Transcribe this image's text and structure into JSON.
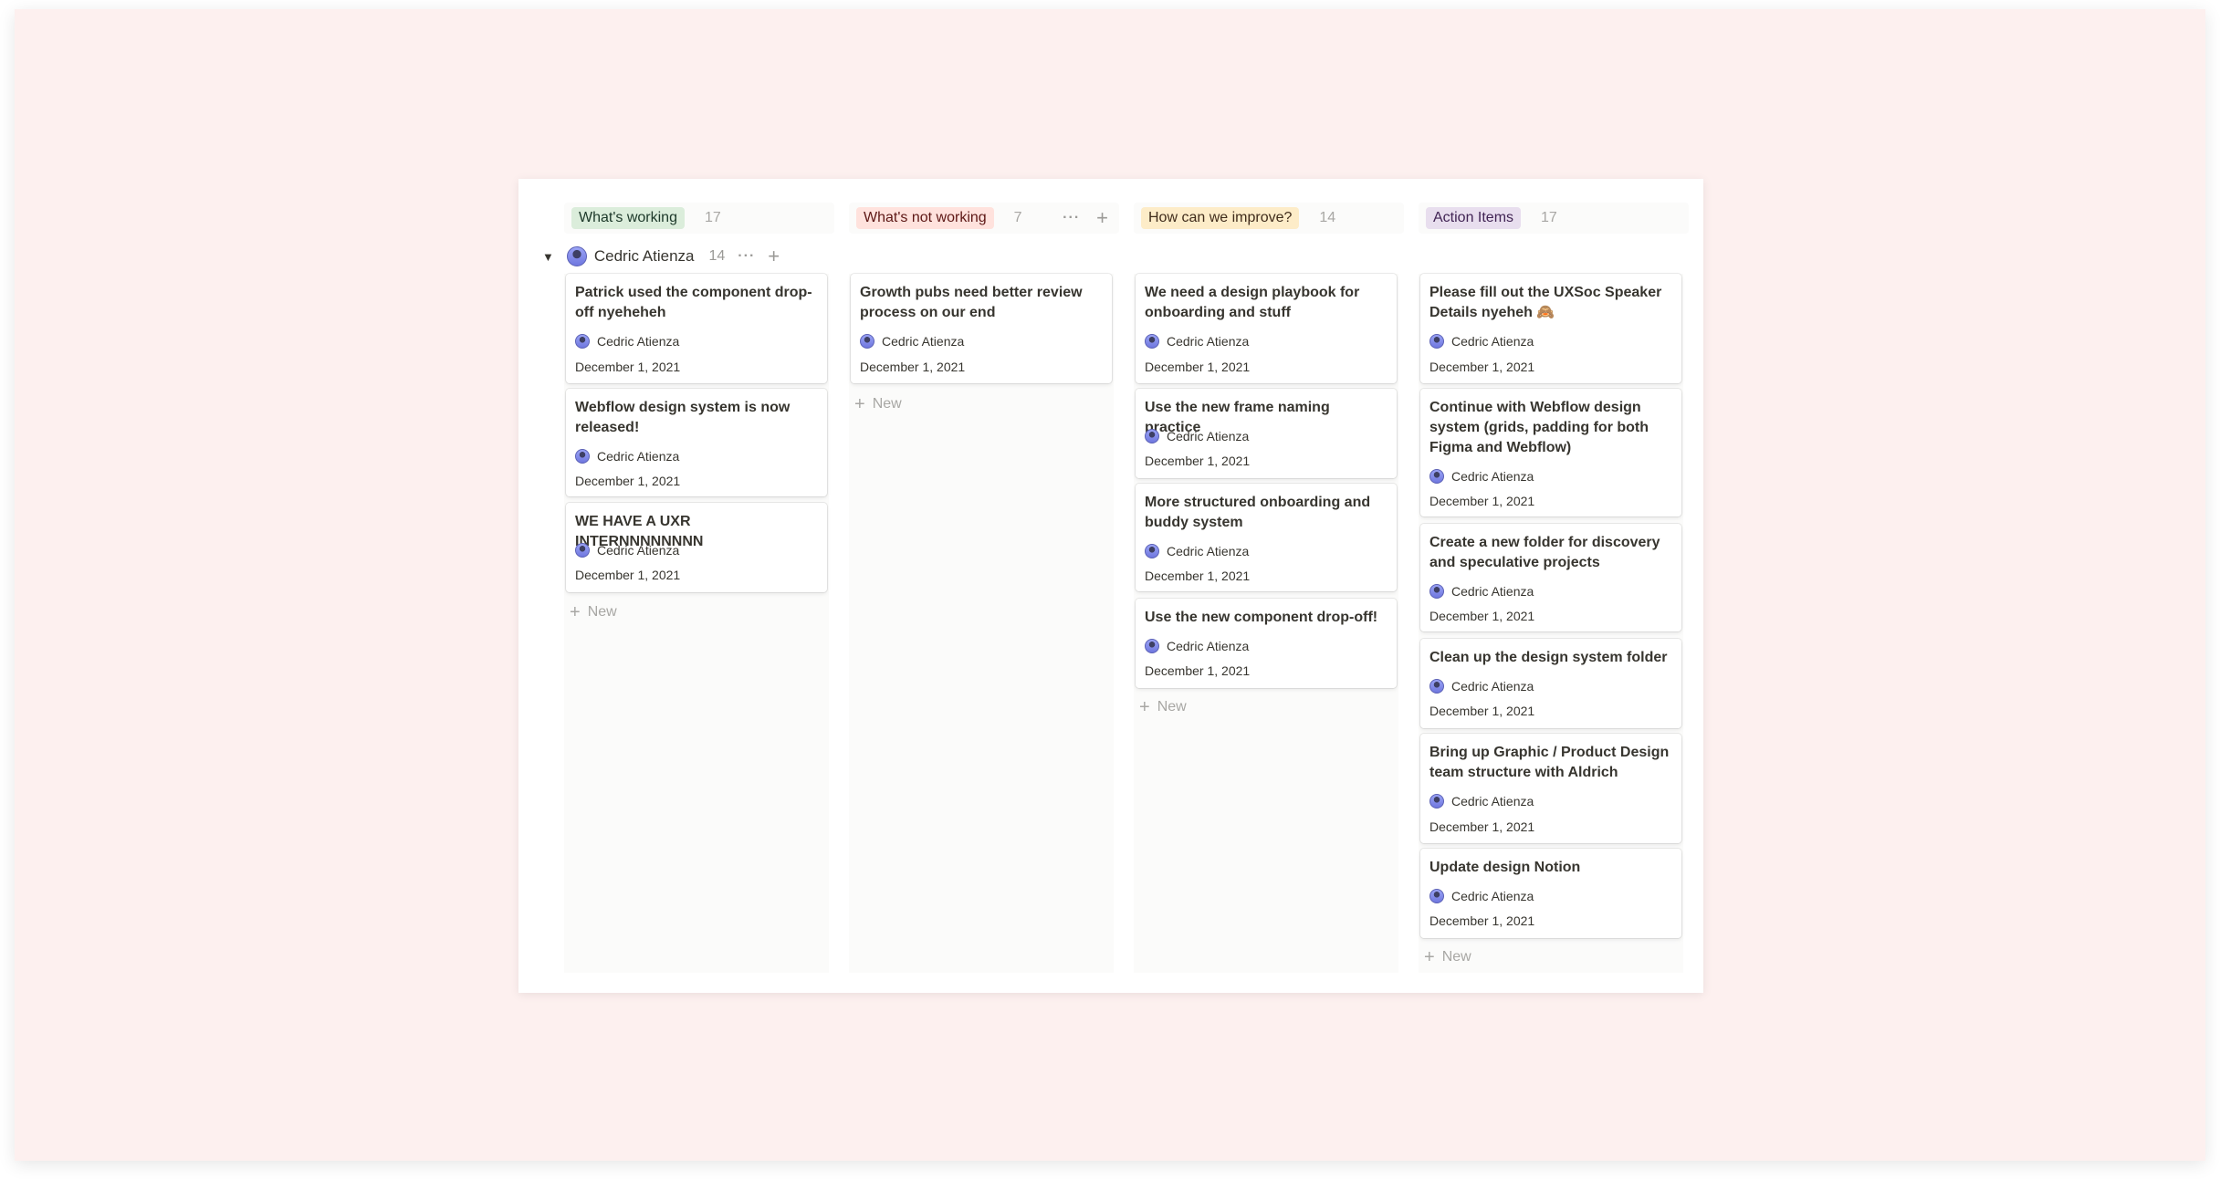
{
  "columns": [
    {
      "title": "What's working",
      "count": "17",
      "pill_bg": "#dbeddb",
      "pill_fg": "#1c3829",
      "cards": [
        {
          "title": "Patrick used the component drop-off nyeheheh",
          "person": "Cedric Atienza",
          "date": "December 1, 2021"
        },
        {
          "title": "Webflow design system is now released!",
          "person": "Cedric Atienza",
          "date": "December 1, 2021"
        },
        {
          "title": "WE HAVE A UXR INTERNNNNNNNN",
          "person": "Cedric Atienza",
          "date": "December 1, 2021"
        }
      ]
    },
    {
      "title": "What's not working",
      "count": "7",
      "pill_bg": "#ffe2dd",
      "pill_fg": "#5d1715",
      "cards": [
        {
          "title": "Growth pubs need better review process on our end",
          "person": "Cedric Atienza",
          "date": "December 1, 2021"
        }
      ]
    },
    {
      "title": "How can we improve?",
      "count": "14",
      "pill_bg": "#fdecc8",
      "pill_fg": "#402c1b",
      "cards": [
        {
          "title": "We need a design playbook for onboarding and stuff",
          "person": "Cedric Atienza",
          "date": "December 1, 2021"
        },
        {
          "title": "Use the new frame naming practice",
          "person": "Cedric Atienza",
          "date": "December 1, 2021"
        },
        {
          "title": "More structured onboarding and buddy system",
          "person": "Cedric Atienza",
          "date": "December 1, 2021"
        },
        {
          "title": "Use the new component drop-off!",
          "person": "Cedric Atienza",
          "date": "December 1, 2021"
        }
      ]
    },
    {
      "title": "Action Items",
      "count": "17",
      "pill_bg": "#e8deee",
      "pill_fg": "#412454",
      "cards": [
        {
          "title": "Please fill out the UXSoc Speaker Details nyeheh 🙈",
          "person": "Cedric Atienza",
          "date": "December 1, 2021"
        },
        {
          "title": "Continue with Webflow design system (grids, padding for both Figma and Webflow)",
          "person": "Cedric Atienza",
          "date": "December 1, 2021"
        },
        {
          "title": "Create a new folder for discovery and speculative projects",
          "person": "Cedric Atienza",
          "date": "December 1, 2021"
        },
        {
          "title": "Clean up the design system folder",
          "person": "Cedric Atienza",
          "date": "December 1, 2021"
        },
        {
          "title": "Bring up Graphic / Product Design team structure with Aldrich",
          "person": "Cedric Atienza",
          "date": "December 1, 2021"
        },
        {
          "title": "Update design Notion",
          "person": "Cedric Atienza",
          "date": "December 1, 2021"
        }
      ]
    }
  ],
  "group": {
    "name": "Cedric Atienza",
    "count": "14"
  },
  "new_label": "New",
  "icons": {
    "caret": "caret-down-icon",
    "dots": "more-icon",
    "plus": "plus-icon",
    "avatar": "avatar"
  }
}
